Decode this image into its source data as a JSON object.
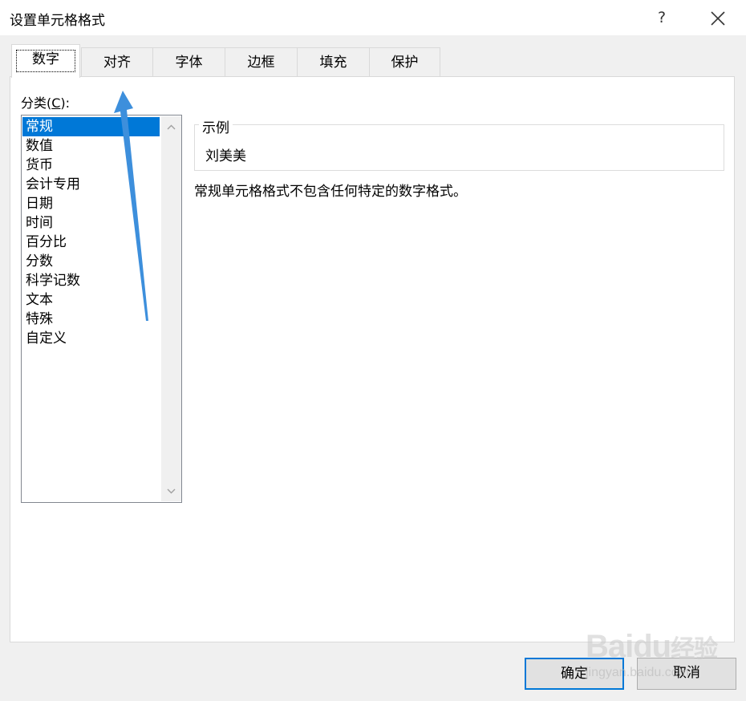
{
  "dialog": {
    "title": "设置单元格格式",
    "help_label": "?",
    "close_icon": "close-icon"
  },
  "tabs": [
    {
      "label": "数字",
      "active": true
    },
    {
      "label": "对齐",
      "active": false
    },
    {
      "label": "字体",
      "active": false
    },
    {
      "label": "边框",
      "active": false
    },
    {
      "label": "填充",
      "active": false
    },
    {
      "label": "保护",
      "active": false
    }
  ],
  "category": {
    "label_prefix": "分类(",
    "label_key": "C",
    "label_suffix": "):",
    "items": [
      "常规",
      "数值",
      "货币",
      "会计专用",
      "日期",
      "时间",
      "百分比",
      "分数",
      "科学记数",
      "文本",
      "特殊",
      "自定义"
    ],
    "selected": "常规"
  },
  "sample": {
    "legend": "示例",
    "value": "刘美美"
  },
  "description": "常规单元格格式不包含任何特定的数字格式。",
  "buttons": {
    "ok": "确定",
    "cancel": "取消"
  },
  "colors": {
    "selection": "#0078d7",
    "arrow": "#3d8fdc"
  },
  "watermark": {
    "brand": "Baidu",
    "cn": "经验",
    "sub": "jingyan.baidu.com"
  }
}
